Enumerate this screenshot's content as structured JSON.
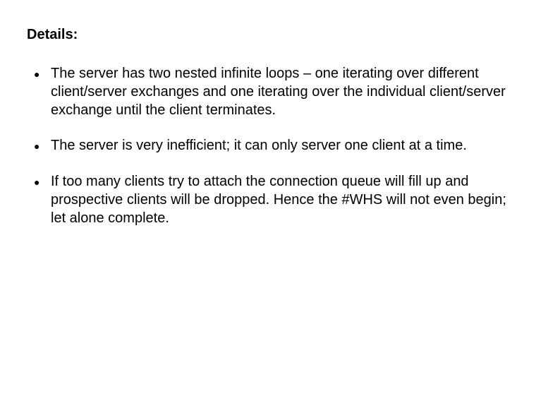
{
  "title": "Details:",
  "bullets": [
    "The server has two nested infinite loops – one iterating over different client/server exchanges and one iterating over the individual client/server exchange until the client terminates.",
    "The server is very inefficient; it can only server one client at a time.",
    "If too many clients try to attach the connection queue will fill up and prospective clients will be dropped. Hence the #WHS will not even begin; let alone complete."
  ]
}
